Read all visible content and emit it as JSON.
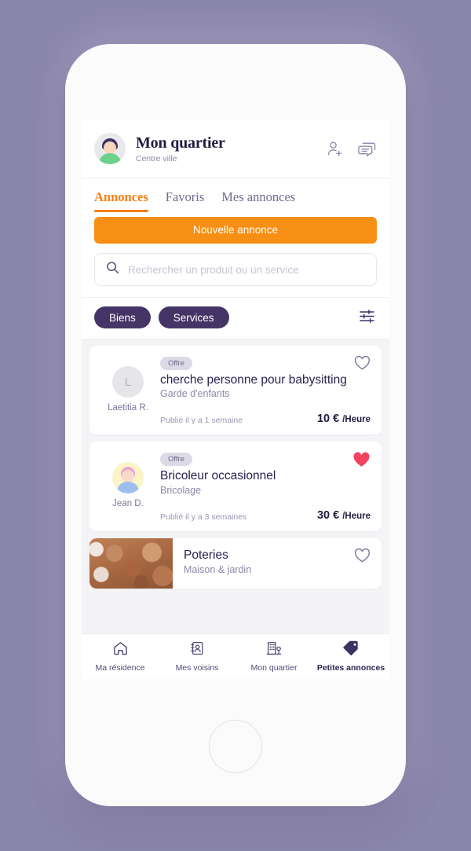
{
  "theme": {
    "bg": "#8b86ac",
    "accent_orange": "#f68010",
    "purple_dark": "#453567",
    "heart_red": "#f2435c",
    "text_dark": "#231a41",
    "text_muted": "#8d88a8"
  },
  "header": {
    "title": "Mon quartier",
    "subtitle": "Centre ville",
    "avatar_icon": "user-avatar",
    "add_user_icon": "add-user-icon",
    "messages_icon": "chat-bubbles-icon"
  },
  "tabs": [
    {
      "label": "Annonces",
      "active": true
    },
    {
      "label": "Favoris",
      "active": false
    },
    {
      "label": "Mes annonces",
      "active": false
    }
  ],
  "new_ad_button": "Nouvelle annonce",
  "search": {
    "placeholder": "Rechercher un produit ou un service",
    "value": "",
    "icon": "search-icon"
  },
  "filters": {
    "chips": [
      "Biens",
      "Services"
    ],
    "settings_icon": "sliders-icon"
  },
  "listings": [
    {
      "badge": "Offre",
      "title": "cherche personne pour babysitting",
      "category": "Garde d'enfants",
      "author": "Laetitia R.",
      "author_initial": "L",
      "avatar_type": "initial",
      "date": "Publié il y a 1 semaine",
      "price": "10 €",
      "price_unit": "/Heure",
      "favorited": false,
      "favorite_icon": "heart-outline-icon"
    },
    {
      "badge": "Offre",
      "title": "Bricoleur occasionnel",
      "category": "Bricolage",
      "author": "Jean D.",
      "author_initial": "J",
      "avatar_type": "photo",
      "date": "Publié il y a 3 semaines",
      "price": "30 €",
      "price_unit": "/Heure",
      "favorited": true,
      "favorite_icon": "heart-filled-icon"
    },
    {
      "title": "Poteries",
      "category": "Maison & jardin",
      "thumbnail": "pottery-photo",
      "favorited": false,
      "favorite_icon": "heart-outline-icon"
    }
  ],
  "bottom_nav": [
    {
      "label": "Ma résidence",
      "icon": "home-icon",
      "active": false
    },
    {
      "label": "Mes voisins",
      "icon": "contacts-icon",
      "active": false
    },
    {
      "label": "Mon quartier",
      "icon": "buildings-icon",
      "active": false
    },
    {
      "label": "Petites annonces",
      "icon": "tag-icon",
      "active": true
    }
  ],
  "home_button": "home-button"
}
